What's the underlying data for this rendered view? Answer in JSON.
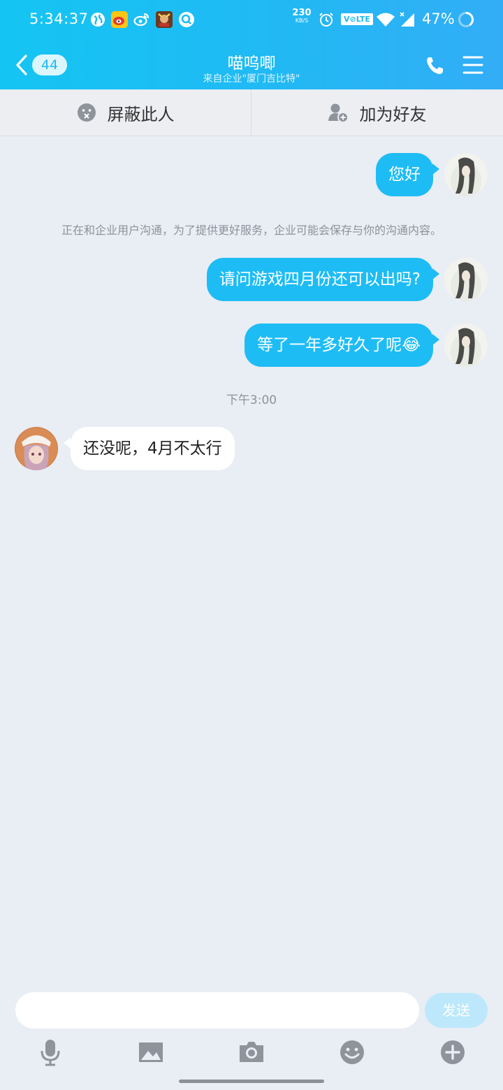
{
  "status_bar": {
    "time": "5:34:37",
    "net_speed_value": "230",
    "net_speed_unit": "KB/S",
    "volte": "V⊘LTE",
    "battery": "47%"
  },
  "header": {
    "unread_count": "44",
    "title": "喵呜唧",
    "subtitle": "来自企业\"厦门吉比特\""
  },
  "actions": {
    "block_label": "屏蔽此人",
    "add_friend_label": "加为好友"
  },
  "messages": [
    {
      "from": "me",
      "text": "您好"
    },
    {
      "from": "me",
      "text": "请问游戏四月份还可以出吗?"
    },
    {
      "from": "me",
      "text": "等了一年多好久了呢😂"
    },
    {
      "from": "them",
      "text": "还没呢，4月不太行"
    }
  ],
  "notice": "正在和企业用户沟通，为了提供更好服务，企业可能会保存与你的沟通内容。",
  "timestamp": "下午3:00",
  "composer": {
    "send_label": "发送"
  },
  "colors": {
    "accent": "#1ebcf5",
    "background": "#e9edf4",
    "send_disabled": "#bde8fb"
  },
  "icons": [
    "back-chevron-icon",
    "phone-icon",
    "menu-icon",
    "block-icon",
    "add-friend-icon",
    "microphone-icon",
    "image-icon",
    "camera-icon",
    "emoji-icon",
    "plus-icon"
  ]
}
